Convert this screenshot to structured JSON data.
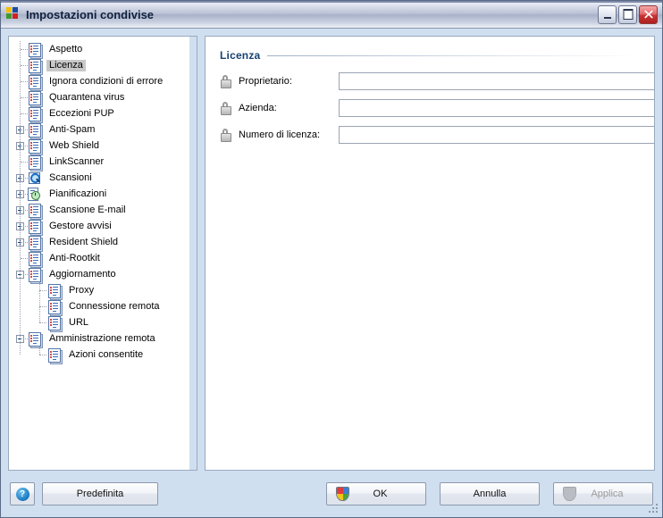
{
  "window": {
    "title": "Impostazioni condivise",
    "icon": "avg-squares-icon",
    "controls": {
      "minimize": "minimize-button",
      "maximize": "maximize-button",
      "close": "close-button"
    }
  },
  "tree": {
    "selected": "Licenza",
    "items": [
      {
        "label": "Aspetto",
        "depth": 1,
        "expander": "none",
        "icon": "doc"
      },
      {
        "label": "Licenza",
        "depth": 1,
        "expander": "none",
        "icon": "doc",
        "selected": true
      },
      {
        "label": "Ignora condizioni di errore",
        "depth": 1,
        "expander": "none",
        "icon": "doc"
      },
      {
        "label": "Quarantena virus",
        "depth": 1,
        "expander": "none",
        "icon": "doc"
      },
      {
        "label": "Eccezioni PUP",
        "depth": 1,
        "expander": "none",
        "icon": "doc"
      },
      {
        "label": "Anti-Spam",
        "depth": 1,
        "expander": "plus",
        "icon": "doc"
      },
      {
        "label": "Web Shield",
        "depth": 1,
        "expander": "plus",
        "icon": "doc"
      },
      {
        "label": "LinkScanner",
        "depth": 1,
        "expander": "none",
        "icon": "doc"
      },
      {
        "label": "Scansioni",
        "depth": 1,
        "expander": "plus",
        "icon": "magnifier"
      },
      {
        "label": "Pianificazioni",
        "depth": 1,
        "expander": "plus",
        "icon": "clock"
      },
      {
        "label": "Scansione E-mail",
        "depth": 1,
        "expander": "plus",
        "icon": "doc"
      },
      {
        "label": "Gestore avvisi",
        "depth": 1,
        "expander": "plus",
        "icon": "doc"
      },
      {
        "label": "Resident Shield",
        "depth": 1,
        "expander": "plus",
        "icon": "doc"
      },
      {
        "label": "Anti-Rootkit",
        "depth": 1,
        "expander": "none",
        "icon": "doc"
      },
      {
        "label": "Aggiornamento",
        "depth": 1,
        "expander": "minus",
        "icon": "doc"
      },
      {
        "label": "Proxy",
        "depth": 2,
        "expander": "none",
        "icon": "doc"
      },
      {
        "label": "Connessione remota",
        "depth": 2,
        "expander": "none",
        "icon": "doc"
      },
      {
        "label": "URL",
        "depth": 2,
        "expander": "none",
        "icon": "doc"
      },
      {
        "label": "Amministrazione remota",
        "depth": 1,
        "expander": "minus",
        "icon": "doc"
      },
      {
        "label": "Azioni consentite",
        "depth": 2,
        "expander": "none",
        "icon": "doc"
      }
    ]
  },
  "detail": {
    "section_title": "Licenza",
    "fields": [
      {
        "label": "Proprietario:",
        "value": "",
        "placeholder": "",
        "lock": "padlock-icon"
      },
      {
        "label": "Azienda:",
        "value": "",
        "placeholder": "",
        "lock": "padlock-icon"
      },
      {
        "label": "Numero di licenza:",
        "value": "",
        "placeholder": "",
        "lock": "padlock-icon"
      }
    ]
  },
  "footer": {
    "help_glyph": "?",
    "default_label": "Predefinita",
    "ok_label": "OK",
    "cancel_label": "Annulla",
    "apply_label": "Applica",
    "apply_disabled": true
  },
  "colors": {
    "window_bg": "#cfdff0",
    "panel_bg": "#ffffff",
    "heading": "#174272",
    "selection": "#c8c8c8",
    "border": "#9aa9bf"
  }
}
